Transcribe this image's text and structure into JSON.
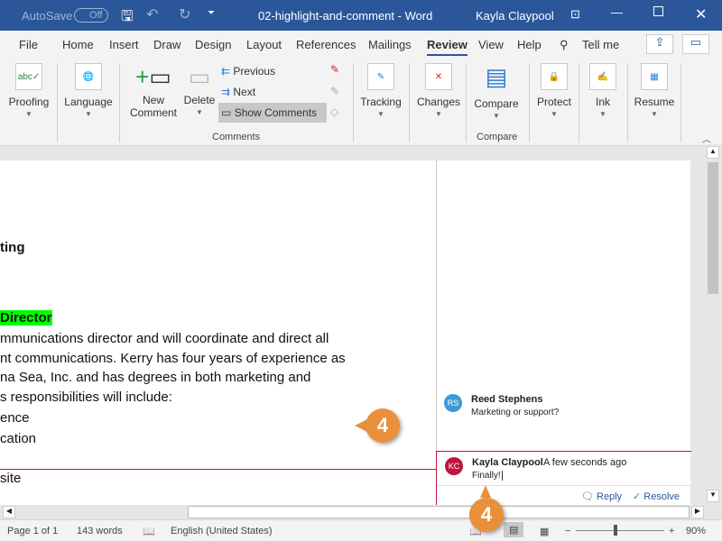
{
  "titlebar": {
    "autosave": "AutoSave",
    "autosave_state": "Off",
    "doc_title": "02-highlight-and-comment - Word",
    "user": "Kayla Claypool"
  },
  "tabs": [
    "File",
    "Home",
    "Insert",
    "Draw",
    "Design",
    "Layout",
    "References",
    "Mailings",
    "Review",
    "View",
    "Help"
  ],
  "active_tab": "Review",
  "tell_me": "Tell me",
  "ribbon": {
    "proofing": "Proofing",
    "language": "Language",
    "new_comment_1": "New",
    "new_comment_2": "Comment",
    "delete": "Delete",
    "previous": "Previous",
    "next": "Next",
    "show_comments": "Show Comments",
    "comments_group": "Comments",
    "tracking": "Tracking",
    "changes": "Changes",
    "compare": "Compare",
    "compare_group": "Compare",
    "protect": "Protect",
    "ink": "Ink",
    "resume": "Resume"
  },
  "document": {
    "lines": [
      "ting",
      "Director",
      "mmunications director and will coordinate and direct all",
      "nt communications. Kerry has four years of experience as",
      "na Sea, Inc. and has degrees in both marketing and",
      "s responsibilities will include:",
      "ence",
      "cation",
      "site"
    ],
    "highlight_color": "#00ff00"
  },
  "comments": [
    {
      "initials": "RS",
      "author": "Reed Stephens",
      "text": "Marketing or support?",
      "color": "#3b9ad9"
    },
    {
      "initials": "KC",
      "author": "Kayla Claypool",
      "time": "A few seconds ago",
      "text": "Finally!",
      "color": "#c0143c",
      "reply": "Reply",
      "resolve": "Resolve"
    }
  ],
  "callouts": [
    "4",
    "4"
  ],
  "status": {
    "page": "Page 1 of 1",
    "words": "143 words",
    "language": "English (United States)",
    "zoom": "90%"
  },
  "colors": {
    "titlebar": "#2b579a",
    "callout": "#e8913a"
  }
}
